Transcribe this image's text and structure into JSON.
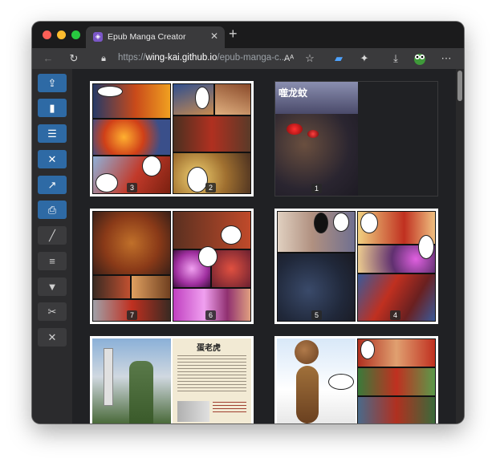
{
  "browser": {
    "tab_title": "Epub Manga Creator",
    "tab_close": "✕",
    "new_tab": "+",
    "url_domain": "wing-kai.github.io",
    "url_scheme": "https://",
    "url_path": "/epub-manga-c...",
    "colors": {
      "red": "#fe5f57",
      "yellow": "#febc2e",
      "green": "#28c840"
    },
    "toolbar_icons": [
      "back-icon",
      "reload-icon",
      "lock-icon",
      "read-aloud-icon",
      "favorites-add-icon",
      "extension-cast-icon",
      "extensions-icon",
      "downloads-icon",
      "profile-icon",
      "more-icon"
    ]
  },
  "sidebar": {
    "buttons": [
      {
        "name": "upload-icon",
        "glyph": "⇪",
        "style": "blue"
      },
      {
        "name": "book-icon",
        "glyph": "▮",
        "style": "blue"
      },
      {
        "name": "list-icon",
        "glyph": "☰",
        "style": "blue"
      },
      {
        "name": "tools-icon",
        "glyph": "✕",
        "style": "blue"
      },
      {
        "name": "export-icon",
        "glyph": "↗",
        "style": "blue"
      },
      {
        "name": "save-icon",
        "glyph": "⎙",
        "style": "blue"
      },
      {
        "name": "ruler-icon",
        "glyph": "╱",
        "style": "dark"
      },
      {
        "name": "menu-icon",
        "glyph": "≡",
        "style": "dark"
      },
      {
        "name": "bookmark-icon",
        "glyph": "▼",
        "style": "dark"
      },
      {
        "name": "scissors-icon",
        "glyph": "✂",
        "style": "dark"
      },
      {
        "name": "close-icon",
        "glyph": "✕",
        "style": "dark"
      }
    ]
  },
  "pages": {
    "spread1": {
      "left": "3",
      "right": "2"
    },
    "spread2": {
      "cover": "1",
      "cover_title": "噬龙蚊"
    },
    "spread3": {
      "left": "7",
      "right": "6"
    },
    "spread4": {
      "left": "5",
      "right": "4"
    },
    "spread5_heading": "蛋老虎"
  }
}
